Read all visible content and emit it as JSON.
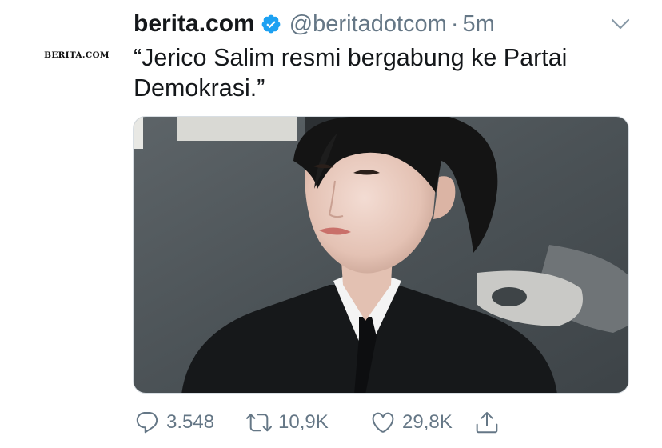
{
  "avatar": {
    "logo_text": "BERITA.COM"
  },
  "tweet": {
    "display_name": "berita.com",
    "verified": true,
    "handle": "@beritadotcom",
    "separator": "·",
    "time": "5m",
    "text": "“Jerico Salim resmi bergabung ke Partai Demokrasi.”"
  },
  "media": {
    "type": "photo"
  },
  "actions": {
    "reply_count": "3.548",
    "retweet_count": "10,9K",
    "like_count": "29,8K"
  },
  "icons": {
    "verified": "verified-badge-icon",
    "chevron": "chevron-down-icon",
    "reply": "reply-icon",
    "retweet": "retweet-icon",
    "like": "heart-icon",
    "share": "share-icon"
  },
  "colors": {
    "name": "#14171a",
    "secondary": "#657786",
    "verified": "#1da1f2"
  }
}
